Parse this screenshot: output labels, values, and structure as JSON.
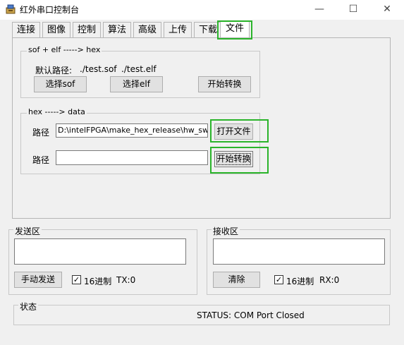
{
  "window": {
    "title": "红外串口控制台",
    "minimize_glyph": "—",
    "maximize_glyph": "☐",
    "close_glyph": "✕"
  },
  "tabs": [
    {
      "label": "连接"
    },
    {
      "label": "图像"
    },
    {
      "label": "控制"
    },
    {
      "label": "算法"
    },
    {
      "label": "高级"
    },
    {
      "label": "上传"
    },
    {
      "label": "下载"
    },
    {
      "label": "文件"
    }
  ],
  "sof_group": {
    "title": "sof + elf -----> hex",
    "default_path_label": "默认路径:",
    "sof_path": "./test.sof",
    "elf_path": "./test.elf",
    "select_sof_button": "选择sof",
    "select_elf_button": "选择elf",
    "convert_button": "开始转换"
  },
  "hex_group": {
    "title": "hex -----> data",
    "path_label_1": "路径",
    "path_value_1": "D:\\intelFPGA\\make_hex_release\\hw_sw.hex",
    "open_file_button": "打开文件",
    "path_label_2": "路径",
    "path_value_2": "",
    "convert_button": "开始转换"
  },
  "send": {
    "title": "发送区",
    "text": "",
    "manual_send_button": "手动发送",
    "hex_checkbox_label": "16进制",
    "hex_checked": true,
    "counter": "TX:0"
  },
  "receive": {
    "title": "接收区",
    "text": "",
    "clear_button": "清除",
    "hex_checkbox_label": "16进制",
    "hex_checked": true,
    "counter": "RX:0"
  },
  "status": {
    "title": "状态",
    "text": "STATUS:  COM Port Closed"
  },
  "colors": {
    "highlight": "#2bb42b",
    "window_bg": "#f0f0f0"
  }
}
